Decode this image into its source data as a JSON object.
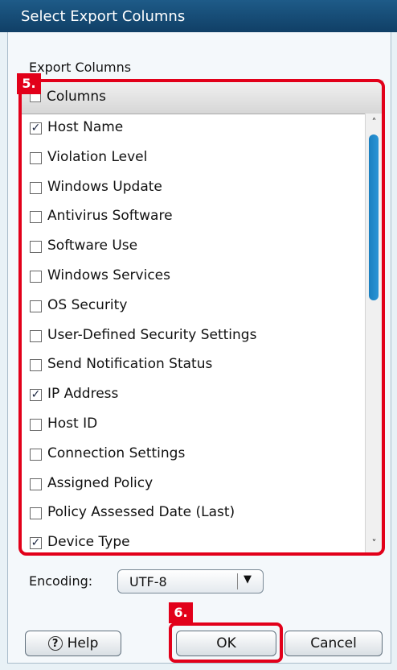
{
  "window": {
    "title": "Select Export Columns"
  },
  "section_label": "Export Columns",
  "header": {
    "label": "Columns",
    "checked": false
  },
  "columns": [
    {
      "label": "Host Name",
      "checked": true
    },
    {
      "label": "Violation Level",
      "checked": false
    },
    {
      "label": "Windows Update",
      "checked": false
    },
    {
      "label": "Antivirus Software",
      "checked": false
    },
    {
      "label": "Software Use",
      "checked": false
    },
    {
      "label": "Windows Services",
      "checked": false
    },
    {
      "label": "OS Security",
      "checked": false
    },
    {
      "label": "User-Defined Security Settings",
      "checked": false
    },
    {
      "label": "Send Notification Status",
      "checked": false
    },
    {
      "label": "IP Address",
      "checked": true
    },
    {
      "label": "Host ID",
      "checked": false
    },
    {
      "label": "Connection Settings",
      "checked": false
    },
    {
      "label": "Assigned Policy",
      "checked": false
    },
    {
      "label": "Policy Assessed Date (Last)",
      "checked": false
    },
    {
      "label": "Device Type",
      "checked": true
    }
  ],
  "encoding": {
    "label": "Encoding:",
    "value": "UTF-8",
    "arrow": "▼"
  },
  "scroll": {
    "up": "˄",
    "down": "˅"
  },
  "steps": {
    "list": "5.",
    "ok": "6."
  },
  "buttons": {
    "help": "Help",
    "help_glyph": "?",
    "ok": "OK",
    "cancel": "Cancel"
  },
  "colors": {
    "highlight": "#e2001a",
    "titlebar": "#1e5b88",
    "scroll_thumb": "#1a7fc0"
  }
}
